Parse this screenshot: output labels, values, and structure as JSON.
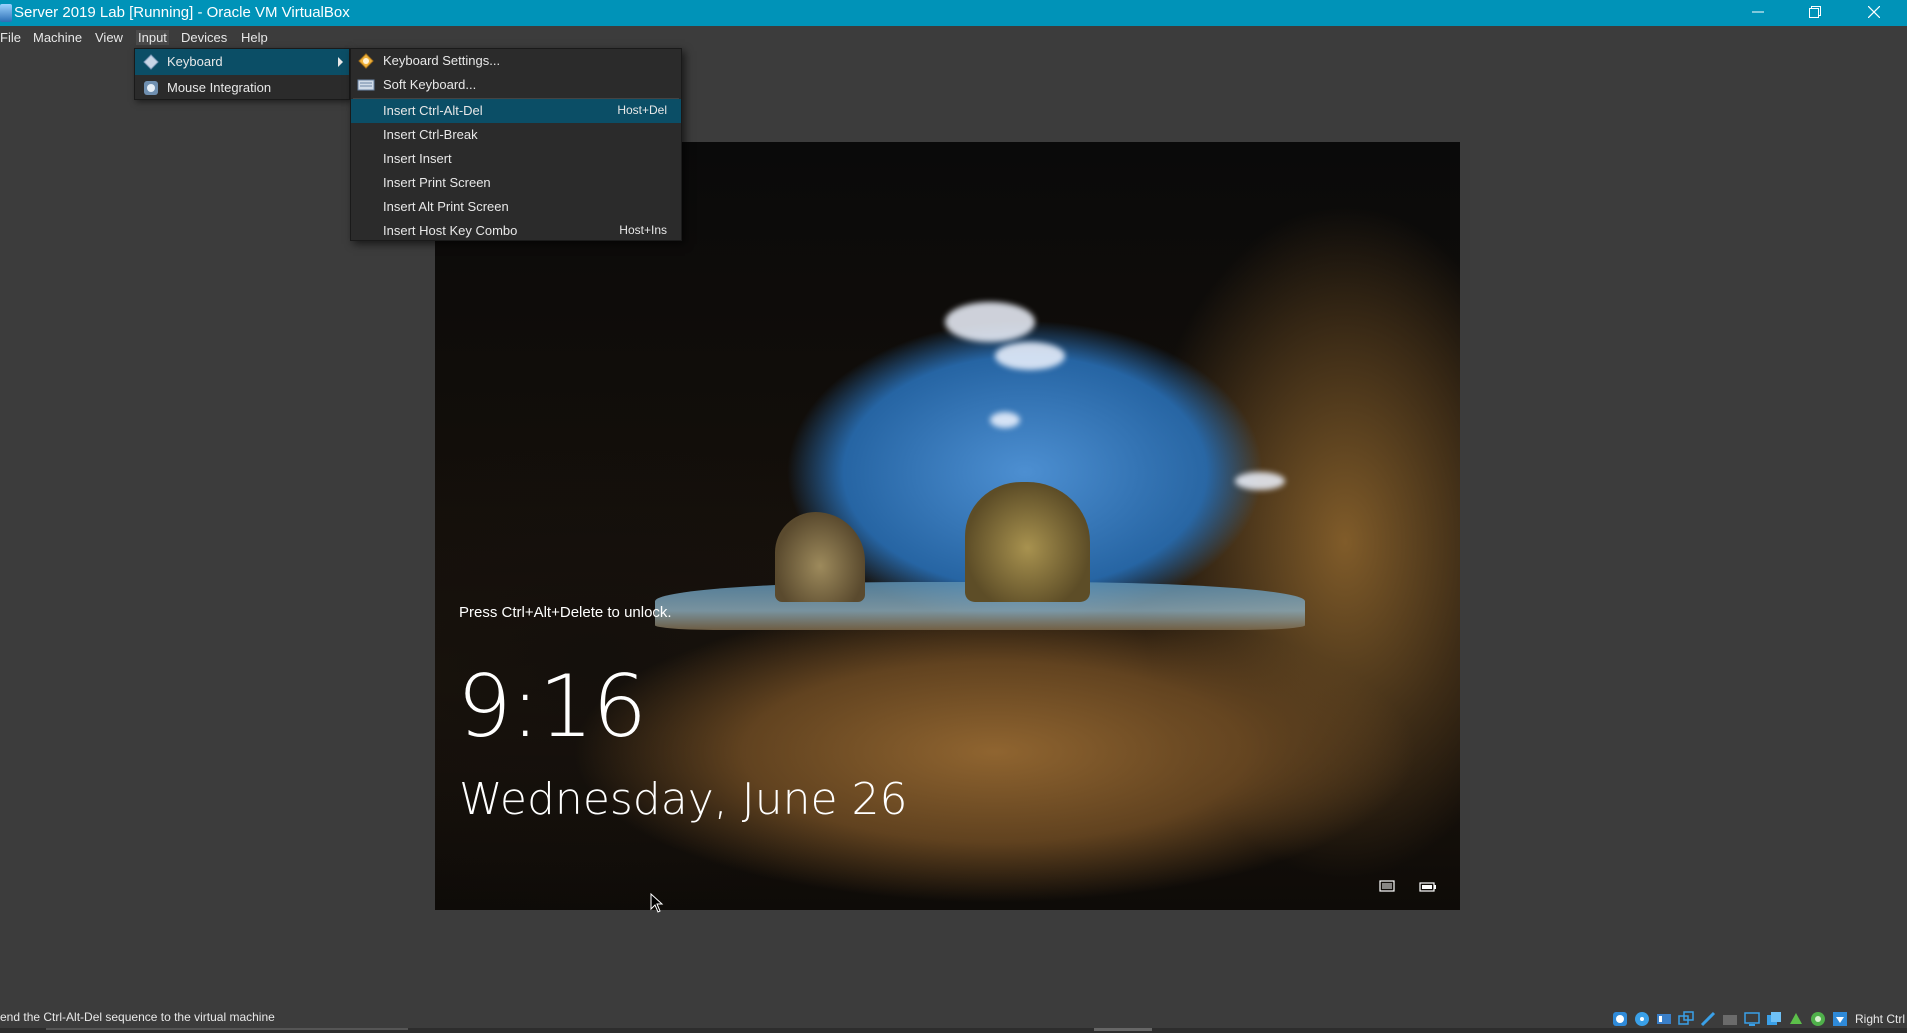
{
  "window": {
    "title": "Server 2019 Lab [Running] - Oracle VM VirtualBox",
    "minimize_icon": "minimize-icon",
    "maximize_icon": "restore-icon",
    "close_icon": "close-icon"
  },
  "menubar": {
    "items": [
      "File",
      "Machine",
      "View",
      "Input",
      "Devices",
      "Help"
    ]
  },
  "input_menu": {
    "items": [
      {
        "label": "Keyboard",
        "icon": "keyboard-icon",
        "has_submenu": true,
        "highlighted": true
      },
      {
        "label": "Mouse Integration",
        "icon": "mouse-integration-icon",
        "has_submenu": false,
        "highlighted": false
      }
    ]
  },
  "keyboard_submenu": {
    "items": [
      {
        "label": "Keyboard Settings...",
        "shortcut": "",
        "icon": "keyboard-settings-icon"
      },
      {
        "label": "Soft Keyboard...",
        "shortcut": "",
        "icon": "soft-keyboard-icon"
      },
      {
        "label": "Insert Ctrl-Alt-Del",
        "shortcut": "Host+Del",
        "highlighted": true
      },
      {
        "label": "Insert Ctrl-Break",
        "shortcut": ""
      },
      {
        "label": "Insert Insert",
        "shortcut": ""
      },
      {
        "label": "Insert Print Screen",
        "shortcut": ""
      },
      {
        "label": "Insert Alt Print Screen",
        "shortcut": ""
      },
      {
        "label": "Insert Host Key Combo",
        "shortcut": "Host+Ins"
      }
    ]
  },
  "vm_screen": {
    "unlock_hint": "Press Ctrl+Alt+Delete to unlock.",
    "time": "9:16",
    "date": "Wednesday, June 26",
    "network_icon": "network-icon",
    "power_icon": "battery-icon"
  },
  "statusbar": {
    "message": "end the Ctrl-Alt-Del sequence to the virtual machine",
    "host_key": "Right Ctrl",
    "icons": [
      "hard-disk-icon",
      "optical-drive-icon",
      "audio-icon",
      "network-adapter-icon",
      "usb-icon",
      "shared-folders-icon",
      "display-icon",
      "recording-icon",
      "capture-icon",
      "mouse-capture-icon",
      "keyboard-capture-icon",
      "arrow-down-icon"
    ]
  },
  "colors": {
    "titlebar": "#0093b8",
    "background": "#3c3c3c",
    "menu_highlight": "#0b4e66"
  }
}
